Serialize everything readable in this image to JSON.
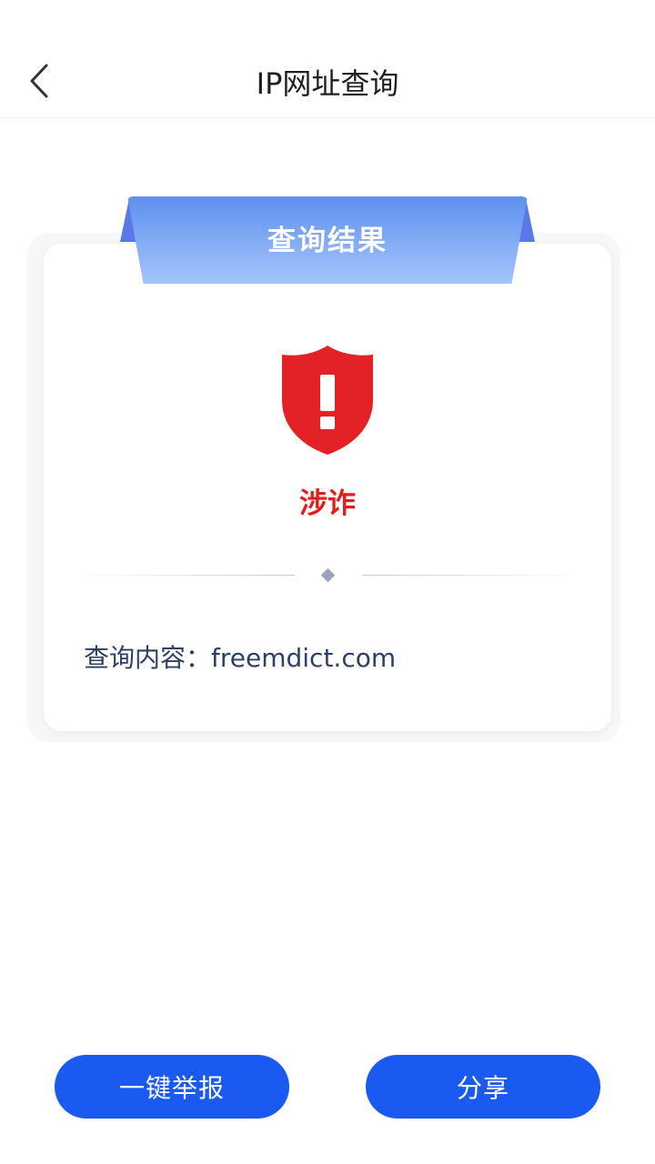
{
  "header": {
    "title": "IP网址查询",
    "back_icon": "chevron-left-icon"
  },
  "card": {
    "ribbon_label": "查询结果",
    "status_icon": "shield-alert-icon",
    "status_color": "#e31c1c",
    "result_label": "涉诈",
    "query_prefix": "查询内容：",
    "query_value": "freemdict.com"
  },
  "actions": {
    "report_label": "一键举报",
    "share_label": "分享",
    "accent_color": "#1a5af0"
  }
}
